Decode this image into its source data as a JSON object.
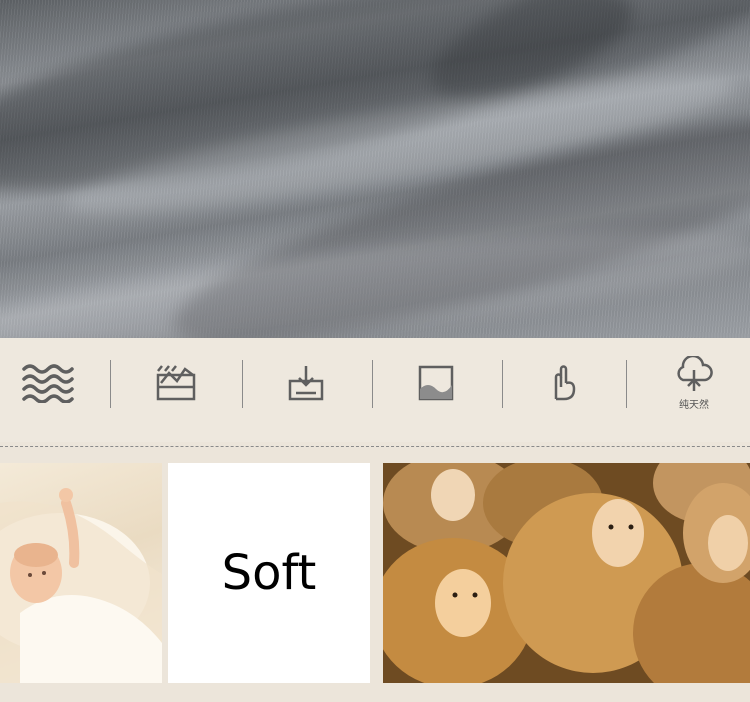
{
  "hero": {
    "subject": "grey-knit-fabric"
  },
  "features": [
    {
      "icon": "waves-icon",
      "caption": ""
    },
    {
      "icon": "stretch-icon",
      "caption": ""
    },
    {
      "icon": "download-tray-icon",
      "caption": ""
    },
    {
      "icon": "frame-landscape-icon",
      "caption": ""
    },
    {
      "icon": "hand-icon",
      "caption": ""
    },
    {
      "icon": "tree-icon",
      "caption": "纯天然"
    }
  ],
  "panels": {
    "soft_label": "Soft"
  },
  "colors": {
    "background": "#ece5da",
    "fabric_grey": "#8c9095",
    "icon_grey": "#5f5f5f",
    "wool": "#c08a45"
  }
}
